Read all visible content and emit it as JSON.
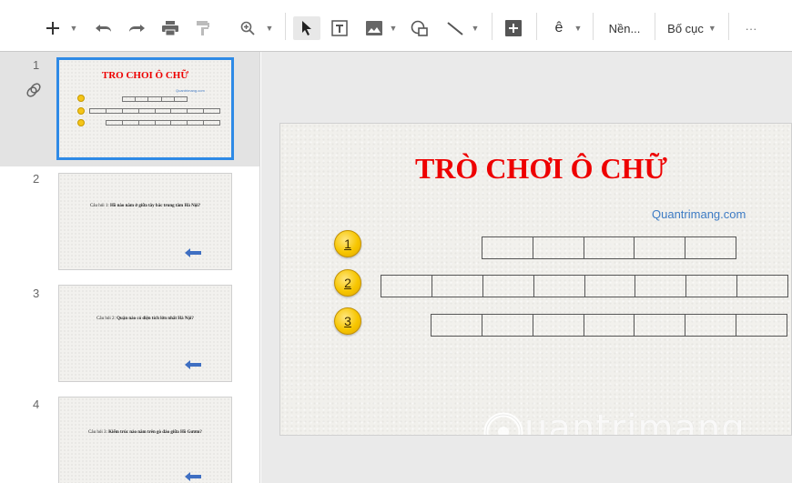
{
  "toolbar": {
    "background_label": "Nền...",
    "layout_label": "Bố cục",
    "text_tool_glyph": "ê",
    "more_label": "···",
    "icons": [
      "plus-icon",
      "undo-icon",
      "redo-icon",
      "print-icon",
      "paint-format-icon",
      "zoom-icon",
      "select-cursor-icon",
      "text-box-icon",
      "image-icon",
      "shape-icon",
      "line-icon",
      "comment-add-icon",
      "more-icon"
    ]
  },
  "filmstrip": {
    "slides": [
      {
        "number": "1",
        "title": "TRO CHOI Ô CHỮ",
        "brand": "Quantrimang.com"
      },
      {
        "number": "2",
        "question_label": "Câu hỏi 1:",
        "question": "Hồ nào nằm ở giữa tây bắc trung tâm Hà Nội?"
      },
      {
        "number": "3",
        "question_label": "Câu hỏi 2:",
        "question": "Quận nào có diện tích lớn nhất Hà Nội?"
      },
      {
        "number": "4",
        "question_label": "Câu hỏi 3:",
        "question": "Kiếm trúc nào nằm trên gò đảo giữa Hồ Gươm?"
      }
    ]
  },
  "slide": {
    "title": "TRÒ CHƠI Ô CHỮ",
    "brand": "Quantrimang.com",
    "badges": [
      "1",
      "2",
      "3"
    ],
    "rows": [
      5,
      8,
      7
    ],
    "watermark": "uantrimang",
    "colors": {
      "title": "#ee0000",
      "brand": "#3d7bc4",
      "badge": "#f7c600",
      "selection": "#2e8ae6"
    }
  }
}
